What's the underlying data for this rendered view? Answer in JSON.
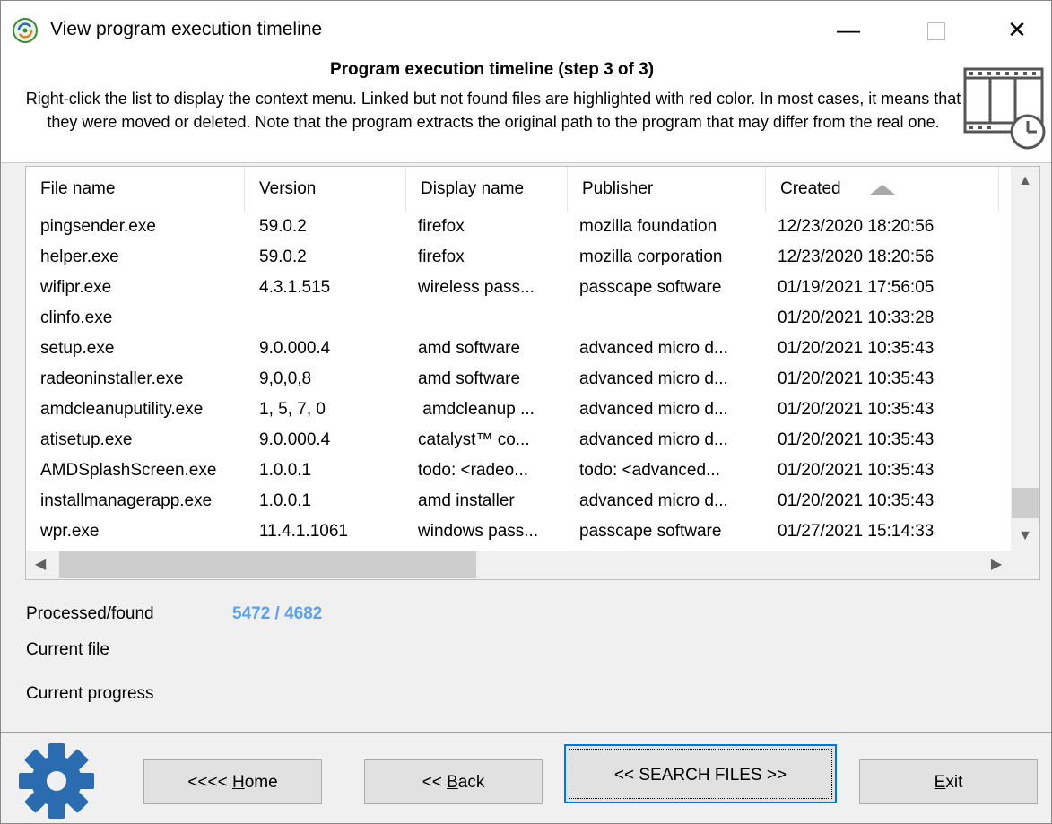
{
  "window": {
    "title": "View program execution timeline",
    "minimize": "—",
    "close": "✕"
  },
  "header": {
    "title": "Program execution timeline (step 3 of 3)",
    "description": "Right-click the list to display the context menu. Linked but not found files are highlighted with red color. In most cases, it means that they were moved or deleted. Note that the program extracts the original path to the program that may differ from the real one."
  },
  "list": {
    "columns": [
      "File name",
      "Version",
      "Display name",
      "Publisher",
      "Created"
    ],
    "sort_column": "Created",
    "rows": [
      [
        "pingsender.exe",
        "59.0.2",
        "firefox",
        "mozilla foundation",
        "12/23/2020 18:20:56"
      ],
      [
        "helper.exe",
        "59.0.2",
        "firefox",
        "mozilla corporation",
        "12/23/2020 18:20:56"
      ],
      [
        "wifipr.exe",
        "4.3.1.515",
        "wireless pass...",
        "passcape software",
        "01/19/2021 17:56:05"
      ],
      [
        "clinfo.exe",
        "",
        "",
        "",
        "01/20/2021 10:33:28"
      ],
      [
        "setup.exe",
        "9.0.000.4",
        "amd software",
        "advanced micro d...",
        "01/20/2021 10:35:43"
      ],
      [
        "radeoninstaller.exe",
        "9,0,0,8",
        "amd software",
        "advanced micro d...",
        "01/20/2021 10:35:43"
      ],
      [
        "amdcleanuputility.exe",
        "1, 5, 7, 0",
        " amdcleanup ...",
        "advanced micro d...",
        "01/20/2021 10:35:43"
      ],
      [
        "atisetup.exe",
        "9.0.000.4",
        "catalyst™ co...",
        "advanced micro d...",
        "01/20/2021 10:35:43"
      ],
      [
        "AMDSplashScreen.exe",
        "1.0.0.1",
        "todo: <radeo...",
        "todo: <advanced...",
        "01/20/2021 10:35:43"
      ],
      [
        "installmanagerapp.exe",
        "1.0.0.1",
        "amd installer",
        "advanced micro d...",
        "01/20/2021 10:35:43"
      ],
      [
        "wpr.exe",
        "11.4.1.1061",
        "windows pass...",
        "passcape software",
        "01/27/2021 15:14:33"
      ]
    ]
  },
  "status": {
    "processed_label": "Processed/found",
    "processed_value": "5472 / 4682",
    "current_file_label": "Current file",
    "current_progress_label": "Current progress"
  },
  "buttons": {
    "home_prefix": "<<<< ",
    "home_key": "H",
    "home_rest": "ome",
    "back_prefix": "<< ",
    "back_key": "B",
    "back_rest": "ack",
    "search": "<< SEARCH FILES >>",
    "exit_key": "E",
    "exit_rest": "xit"
  },
  "colors": {
    "accent": "#0078d7",
    "processed_value": "#5aa2ee",
    "gear": "#2b6cb0"
  },
  "icons": [
    "app-icon",
    "film-clock-icon",
    "gear-icon",
    "sort-ascending-icon",
    "scroll-up-icon",
    "scroll-down-icon",
    "scroll-left-icon",
    "scroll-right-icon"
  ]
}
